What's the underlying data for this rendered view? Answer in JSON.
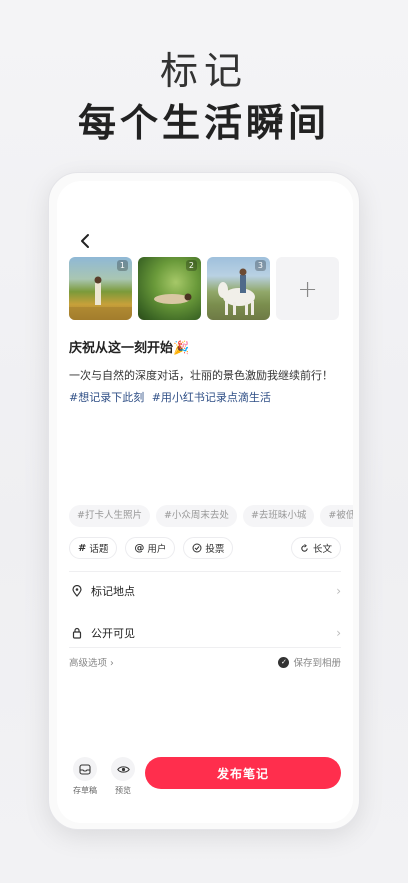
{
  "hero": {
    "subtitle": "标记",
    "title": "每个生活瞬间"
  },
  "post": {
    "images": [
      {
        "index": "1"
      },
      {
        "index": "2"
      },
      {
        "index": "3"
      }
    ],
    "add_label": "+",
    "title": "庆祝从这一刻开始🎉",
    "body": "一次与自然的深度对话，壮丽的景色激励我继续前行！",
    "hashtags": [
      "#想记录下此刻",
      "#用小红书记录点滴生活"
    ]
  },
  "suggested_tags": [
    "#打卡人生照片",
    "#小众周末去处",
    "#去班昧小城",
    "#被低估"
  ],
  "tools": {
    "topic": "话题",
    "user": "用户",
    "vote": "投票",
    "long_text": "长文"
  },
  "settings": {
    "location": "标记地点",
    "visibility": "公开可见",
    "advanced": "高级选项 ›",
    "save_album": "保存到相册"
  },
  "bottom": {
    "draft": "存草稿",
    "preview": "预览",
    "publish": "发布笔记"
  },
  "colors": {
    "accent": "#ff2e4d",
    "hashtag": "#2f4f86"
  }
}
